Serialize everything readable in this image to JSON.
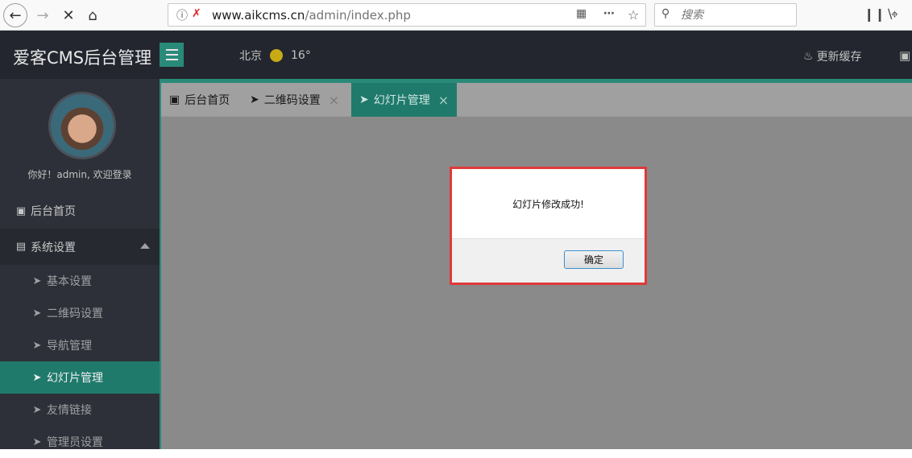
{
  "browser": {
    "url_host": "www.aikcms.cn",
    "url_path": "/admin/index.php",
    "search_placeholder": "搜索",
    "icons": [
      "back-icon",
      "forward-icon",
      "stop-icon",
      "home-icon",
      "info-icon",
      "insecure-icon",
      "qr-icon",
      "more-icon",
      "star-icon",
      "search-icon",
      "library-icon",
      "crop-icon"
    ]
  },
  "header": {
    "title": "爱客CMS后台管理",
    "weather_city": "北京",
    "weather_temp": "16°",
    "refresh_cache": "更新缓存"
  },
  "sidebar": {
    "welcome": "你好！admin, 欢迎登录",
    "items": [
      {
        "label": "后台首页",
        "icon": "monitor-icon"
      },
      {
        "label": "系统设置",
        "icon": "settings-icon",
        "expanded": true
      },
      {
        "label": "基本设置",
        "icon": "send-icon"
      },
      {
        "label": "二维码设置",
        "icon": "send-icon"
      },
      {
        "label": "导航管理",
        "icon": "send-icon"
      },
      {
        "label": "幻灯片管理",
        "icon": "send-icon",
        "active": true
      },
      {
        "label": "友情链接",
        "icon": "send-icon"
      },
      {
        "label": "管理员设置",
        "icon": "send-icon"
      }
    ]
  },
  "tabs": [
    {
      "label": "后台首页",
      "closable": false
    },
    {
      "label": "二维码设置",
      "closable": true
    },
    {
      "label": "幻灯片管理",
      "closable": true,
      "active": true
    }
  ],
  "dialog": {
    "message": "幻灯片修改成功!",
    "ok_label": "确定"
  },
  "colors": {
    "accent": "#1f7a6c",
    "header_bg": "#23262e",
    "sidebar_bg": "#2d3038",
    "highlight_border": "#e0393a"
  }
}
